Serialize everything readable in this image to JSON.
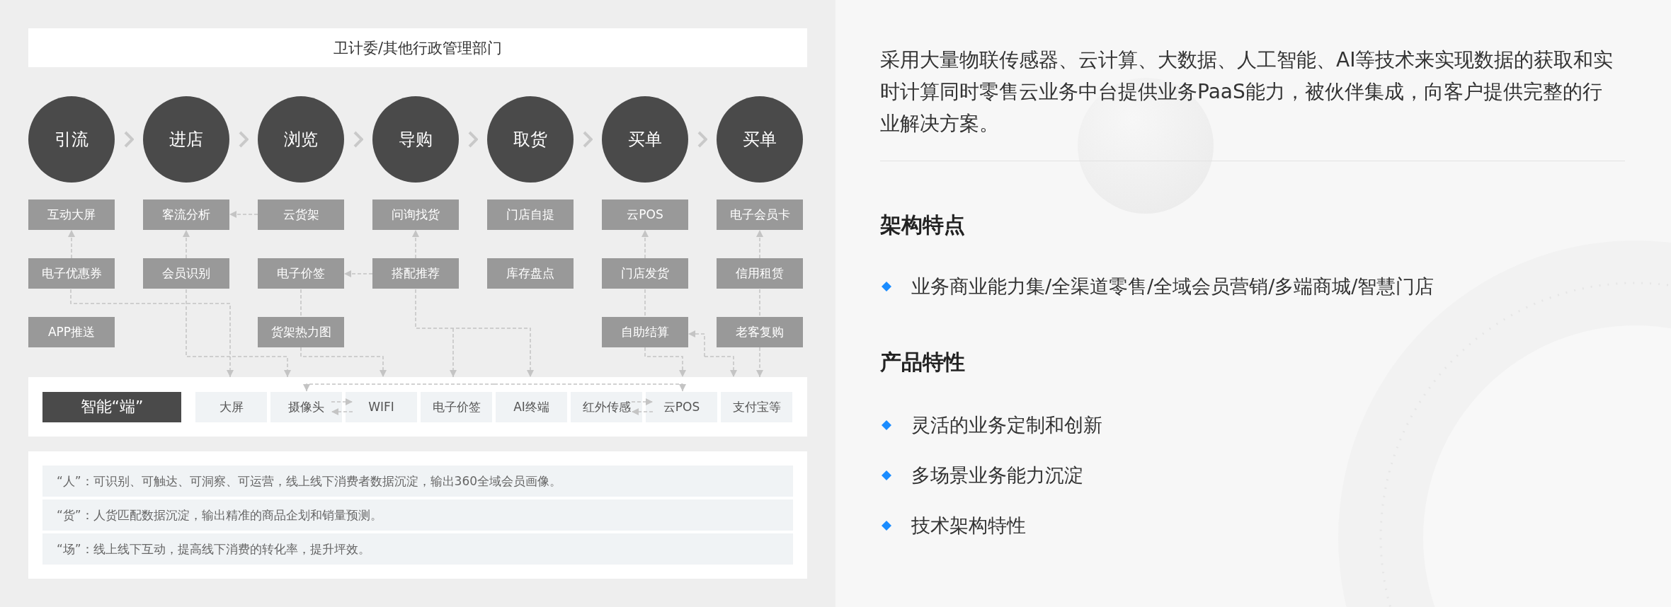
{
  "header": "卫计委/其他行政管理部门",
  "stages": [
    {
      "name": "引流",
      "tools": [
        "互动大屏",
        "电子优惠券",
        "APP推送"
      ]
    },
    {
      "name": "进店",
      "tools": [
        "客流分析",
        "会员识别"
      ]
    },
    {
      "name": "浏览",
      "tools": [
        "云货架",
        "电子价签",
        "货架热力图"
      ]
    },
    {
      "name": "导购",
      "tools": [
        "问询找货",
        "搭配推荐"
      ]
    },
    {
      "name": "取货",
      "tools": [
        "门店自提",
        "库存盘点"
      ]
    },
    {
      "name": "买单",
      "tools": [
        "云POS",
        "门店发货",
        "自助结算"
      ]
    },
    {
      "name": "买单",
      "tools": [
        "电子会员卡",
        "信用租赁",
        "老客复购"
      ]
    }
  ],
  "smart_terminal": {
    "label": "智能“端”",
    "items": [
      "大屏",
      "摄像头",
      "WIFI",
      "电子价签",
      "AI终端",
      "红外传感",
      "云POS",
      "支付宝等"
    ]
  },
  "notes": [
    "“人”：可识别、可触达、可洞察、可运营，线上线下消费者数据沉淀，输出360全域会员画像。",
    "“货”：人货匹配数据沉淀，输出精准的商品企划和销量预测。",
    "“场”：线上线下互动，提高线下消费的转化率，提升坪效。"
  ],
  "intro": "采用大量物联传感器、云计算、大数据、人工智能、AI等技术来实现数据的获取和实时计算同时零售云业务中台提供业务PaaS能力，被伙伴集成，向客户提供完整的行业解决方案。",
  "sections": [
    {
      "title": "架构特点",
      "items": [
        "业务商业能力集/全渠道零售/全域会员营销/多端商城/智慧门店"
      ]
    },
    {
      "title": "产品特性",
      "items": [
        "灵活的业务定制和创新",
        "多场景业务能力沉淀",
        "技术架构特性"
      ]
    }
  ]
}
